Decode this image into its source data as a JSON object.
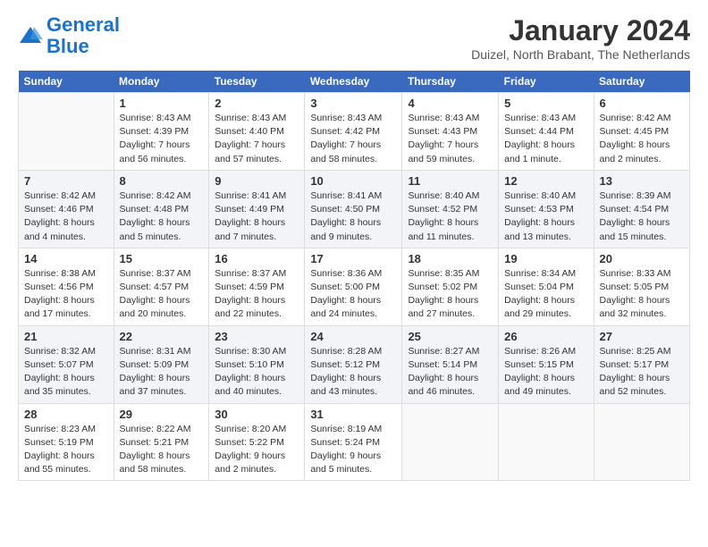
{
  "logo": {
    "line1": "General",
    "line2": "Blue"
  },
  "header": {
    "month": "January 2024",
    "location": "Duizel, North Brabant, The Netherlands"
  },
  "weekdays": [
    "Sunday",
    "Monday",
    "Tuesday",
    "Wednesday",
    "Thursday",
    "Friday",
    "Saturday"
  ],
  "weeks": [
    [
      {
        "day": "",
        "info": ""
      },
      {
        "day": "1",
        "info": "Sunrise: 8:43 AM\nSunset: 4:39 PM\nDaylight: 7 hours\nand 56 minutes."
      },
      {
        "day": "2",
        "info": "Sunrise: 8:43 AM\nSunset: 4:40 PM\nDaylight: 7 hours\nand 57 minutes."
      },
      {
        "day": "3",
        "info": "Sunrise: 8:43 AM\nSunset: 4:42 PM\nDaylight: 7 hours\nand 58 minutes."
      },
      {
        "day": "4",
        "info": "Sunrise: 8:43 AM\nSunset: 4:43 PM\nDaylight: 7 hours\nand 59 minutes."
      },
      {
        "day": "5",
        "info": "Sunrise: 8:43 AM\nSunset: 4:44 PM\nDaylight: 8 hours\nand 1 minute."
      },
      {
        "day": "6",
        "info": "Sunrise: 8:42 AM\nSunset: 4:45 PM\nDaylight: 8 hours\nand 2 minutes."
      }
    ],
    [
      {
        "day": "7",
        "info": "Sunrise: 8:42 AM\nSunset: 4:46 PM\nDaylight: 8 hours\nand 4 minutes."
      },
      {
        "day": "8",
        "info": "Sunrise: 8:42 AM\nSunset: 4:48 PM\nDaylight: 8 hours\nand 5 minutes."
      },
      {
        "day": "9",
        "info": "Sunrise: 8:41 AM\nSunset: 4:49 PM\nDaylight: 8 hours\nand 7 minutes."
      },
      {
        "day": "10",
        "info": "Sunrise: 8:41 AM\nSunset: 4:50 PM\nDaylight: 8 hours\nand 9 minutes."
      },
      {
        "day": "11",
        "info": "Sunrise: 8:40 AM\nSunset: 4:52 PM\nDaylight: 8 hours\nand 11 minutes."
      },
      {
        "day": "12",
        "info": "Sunrise: 8:40 AM\nSunset: 4:53 PM\nDaylight: 8 hours\nand 13 minutes."
      },
      {
        "day": "13",
        "info": "Sunrise: 8:39 AM\nSunset: 4:54 PM\nDaylight: 8 hours\nand 15 minutes."
      }
    ],
    [
      {
        "day": "14",
        "info": "Sunrise: 8:38 AM\nSunset: 4:56 PM\nDaylight: 8 hours\nand 17 minutes."
      },
      {
        "day": "15",
        "info": "Sunrise: 8:37 AM\nSunset: 4:57 PM\nDaylight: 8 hours\nand 20 minutes."
      },
      {
        "day": "16",
        "info": "Sunrise: 8:37 AM\nSunset: 4:59 PM\nDaylight: 8 hours\nand 22 minutes."
      },
      {
        "day": "17",
        "info": "Sunrise: 8:36 AM\nSunset: 5:00 PM\nDaylight: 8 hours\nand 24 minutes."
      },
      {
        "day": "18",
        "info": "Sunrise: 8:35 AM\nSunset: 5:02 PM\nDaylight: 8 hours\nand 27 minutes."
      },
      {
        "day": "19",
        "info": "Sunrise: 8:34 AM\nSunset: 5:04 PM\nDaylight: 8 hours\nand 29 minutes."
      },
      {
        "day": "20",
        "info": "Sunrise: 8:33 AM\nSunset: 5:05 PM\nDaylight: 8 hours\nand 32 minutes."
      }
    ],
    [
      {
        "day": "21",
        "info": "Sunrise: 8:32 AM\nSunset: 5:07 PM\nDaylight: 8 hours\nand 35 minutes."
      },
      {
        "day": "22",
        "info": "Sunrise: 8:31 AM\nSunset: 5:09 PM\nDaylight: 8 hours\nand 37 minutes."
      },
      {
        "day": "23",
        "info": "Sunrise: 8:30 AM\nSunset: 5:10 PM\nDaylight: 8 hours\nand 40 minutes."
      },
      {
        "day": "24",
        "info": "Sunrise: 8:28 AM\nSunset: 5:12 PM\nDaylight: 8 hours\nand 43 minutes."
      },
      {
        "day": "25",
        "info": "Sunrise: 8:27 AM\nSunset: 5:14 PM\nDaylight: 8 hours\nand 46 minutes."
      },
      {
        "day": "26",
        "info": "Sunrise: 8:26 AM\nSunset: 5:15 PM\nDaylight: 8 hours\nand 49 minutes."
      },
      {
        "day": "27",
        "info": "Sunrise: 8:25 AM\nSunset: 5:17 PM\nDaylight: 8 hours\nand 52 minutes."
      }
    ],
    [
      {
        "day": "28",
        "info": "Sunrise: 8:23 AM\nSunset: 5:19 PM\nDaylight: 8 hours\nand 55 minutes."
      },
      {
        "day": "29",
        "info": "Sunrise: 8:22 AM\nSunset: 5:21 PM\nDaylight: 8 hours\nand 58 minutes."
      },
      {
        "day": "30",
        "info": "Sunrise: 8:20 AM\nSunset: 5:22 PM\nDaylight: 9 hours\nand 2 minutes."
      },
      {
        "day": "31",
        "info": "Sunrise: 8:19 AM\nSunset: 5:24 PM\nDaylight: 9 hours\nand 5 minutes."
      },
      {
        "day": "",
        "info": ""
      },
      {
        "day": "",
        "info": ""
      },
      {
        "day": "",
        "info": ""
      }
    ]
  ]
}
